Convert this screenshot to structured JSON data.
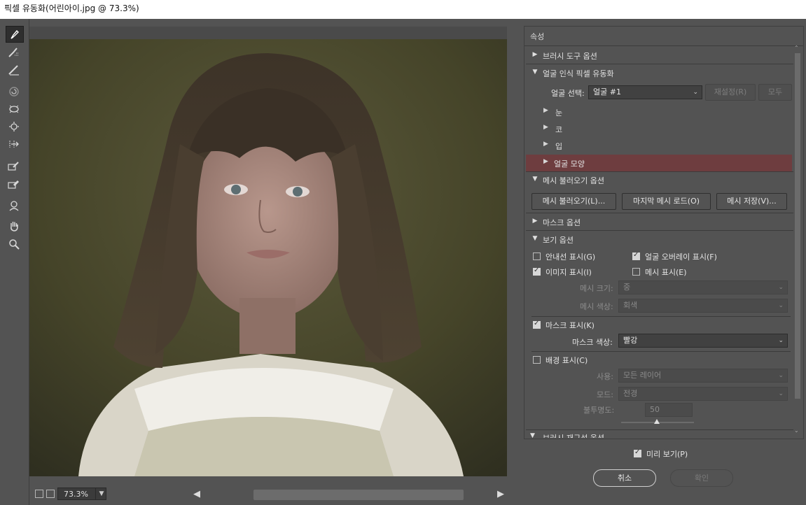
{
  "window": {
    "title": "픽셀 유동화(어린아이.jpg @ 73.3%)"
  },
  "toolbar": {
    "tools": [
      "forward-warp-tool",
      "reconstruct-tool",
      "smooth-tool",
      "twirl-clockwise-tool",
      "pucker-tool",
      "bloat-tool",
      "push-left-tool",
      "freeze-mask-tool",
      "thaw-mask-tool",
      "face-tool",
      "hand-tool",
      "zoom-tool"
    ]
  },
  "statusbar": {
    "zoom": "73.3%"
  },
  "panel": {
    "title": "속성",
    "brush_tool_options": "브러시 도구 옵션",
    "face_aware_liquify": "얼굴 인식 픽셀 유동화",
    "select_face_label": "얼굴 선택:",
    "select_face_value": "얼굴 #1",
    "reset_button": "재설정(R)",
    "all_button": "모두",
    "eyes": "눈",
    "nose": "코",
    "mouth": "입",
    "face_shape": "얼굴 모양",
    "load_mesh_options": "메시 불러오기 옵션",
    "load_mesh_button": "메시 불러오기(L)...",
    "load_last_mesh_button": "마지막 메시 로드(O)",
    "save_mesh_button": "메시 저장(V)...",
    "mask_options": "마스크 옵션",
    "view_options": "보기 옵션",
    "show_guides": "안내선 표시(G)",
    "show_face_overlay": "얼굴 오버레이 표시(F)",
    "show_image": "이미지 표시(I)",
    "show_mesh": "메시 표시(E)",
    "mesh_size_label": "메시 크기:",
    "mesh_size_value": "중",
    "mesh_color_label": "메시 색상:",
    "mesh_color_value": "회색",
    "show_mask": "마스크 표시(K)",
    "mask_color_label": "마스크 색상:",
    "mask_color_value": "빨강",
    "show_backdrop": "배경 표시(C)",
    "use_label": "사용:",
    "use_value": "모든 레이어",
    "mode_label": "모드:",
    "mode_value": "전경",
    "opacity_label": "불투명도:",
    "opacity_value": "50",
    "brush_reconstruct_options": "브러시 재구성 옵션"
  },
  "checks": {
    "show_guides": false,
    "show_face_overlay": true,
    "show_image": true,
    "show_mesh": false,
    "show_mask": true,
    "show_backdrop": false,
    "preview": true
  },
  "footer": {
    "preview_label": "미리 보기(P)",
    "cancel_label": "취소",
    "ok_label": "확인"
  },
  "colors": {
    "panel_bg": "#535353",
    "highlight": "#6e3d3f",
    "dark_field": "#414141"
  }
}
